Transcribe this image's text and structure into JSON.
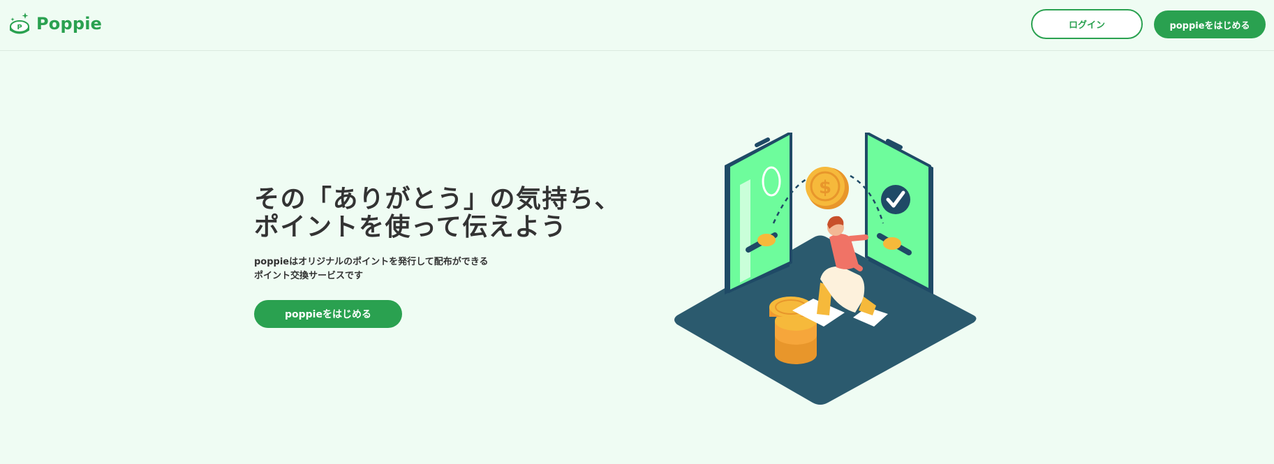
{
  "header": {
    "logo_text": "Poppie",
    "login_label": "ログイン",
    "start_label": "poppieをはじめる"
  },
  "hero": {
    "title_line1": "その「ありがとう」の気持ち、",
    "title_line2": "ポイントを使って伝えよう",
    "description_line1": "poppieはオリジナルのポイントを発行して配布ができる",
    "description_line2": "ポイント交換サービスです",
    "cta_label": "poppieをはじめる"
  },
  "colors": {
    "brand_green": "#2aa150",
    "background": "#effcf3",
    "phone_screen": "#6efc9c",
    "platform": "#2b5a6e",
    "coin": "#f6b93b"
  },
  "illustration": {
    "coin_symbol": "$"
  }
}
